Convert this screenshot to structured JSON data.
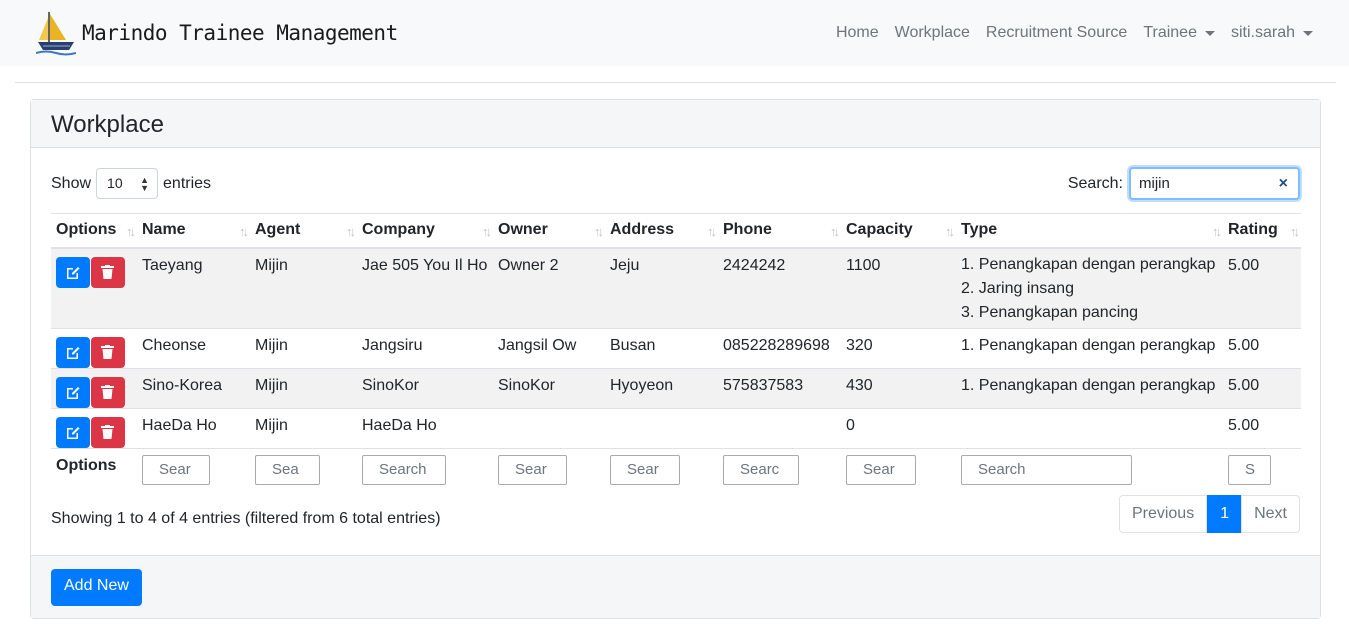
{
  "navbar": {
    "brand": "Marindo Trainee Management",
    "links": [
      "Home",
      "Workplace",
      "Recruitment Source",
      "Trainee",
      "siti.sarah"
    ]
  },
  "card": {
    "title": "Workplace",
    "length_label_pre": "Show",
    "length_value": "10",
    "length_label_post": "entries",
    "search_label": "Search:",
    "search_value": "mijin",
    "columns": [
      "Options",
      "Name",
      "Agent",
      "Company",
      "Owner",
      "Address",
      "Phone",
      "Capacity",
      "Type",
      "Rating"
    ],
    "rows": [
      {
        "name": "Taeyang",
        "agent": "Mijin",
        "company": "Jae 505 You Il Ho",
        "owner": "Owner 2",
        "address": "Jeju",
        "phone": "2424242",
        "capacity": "1100",
        "type": [
          "1. Penangkapan dengan perangkap",
          "2. Jaring insang",
          "3. Penangkapan pancing"
        ],
        "rating": "5.00"
      },
      {
        "name": "Cheonse",
        "agent": "Mijin",
        "company": "Jangsiru",
        "owner": "Jangsil Ow",
        "address": "Busan",
        "phone": "085228289698",
        "capacity": "320",
        "type": [
          "1. Penangkapan dengan perangkap"
        ],
        "rating": "5.00"
      },
      {
        "name": "Sino-Korea",
        "agent": "Mijin",
        "company": "SinoKor",
        "owner": "SinoKor",
        "address": "Hyoyeon",
        "phone": "575837583",
        "capacity": "430",
        "type": [
          "1. Penangkapan dengan perangkap"
        ],
        "rating": "5.00"
      },
      {
        "name": "HaeDa Ho",
        "agent": "Mijin",
        "company": "HaeDa Ho",
        "owner": "",
        "address": "",
        "phone": "",
        "capacity": "0",
        "type": [],
        "rating": "5.00"
      }
    ],
    "footer_label": "Options",
    "column_search_placeholders": [
      "Sear",
      "Sea",
      "Search",
      "Sear",
      "Sear",
      "Searc",
      "Sear",
      "Search",
      "S"
    ],
    "info": "Showing 1 to 4 of 4 entries (filtered from 6 total entries)",
    "pagination": {
      "prev": "Previous",
      "page": "1",
      "next": "Next"
    },
    "add_button": "Add New"
  }
}
